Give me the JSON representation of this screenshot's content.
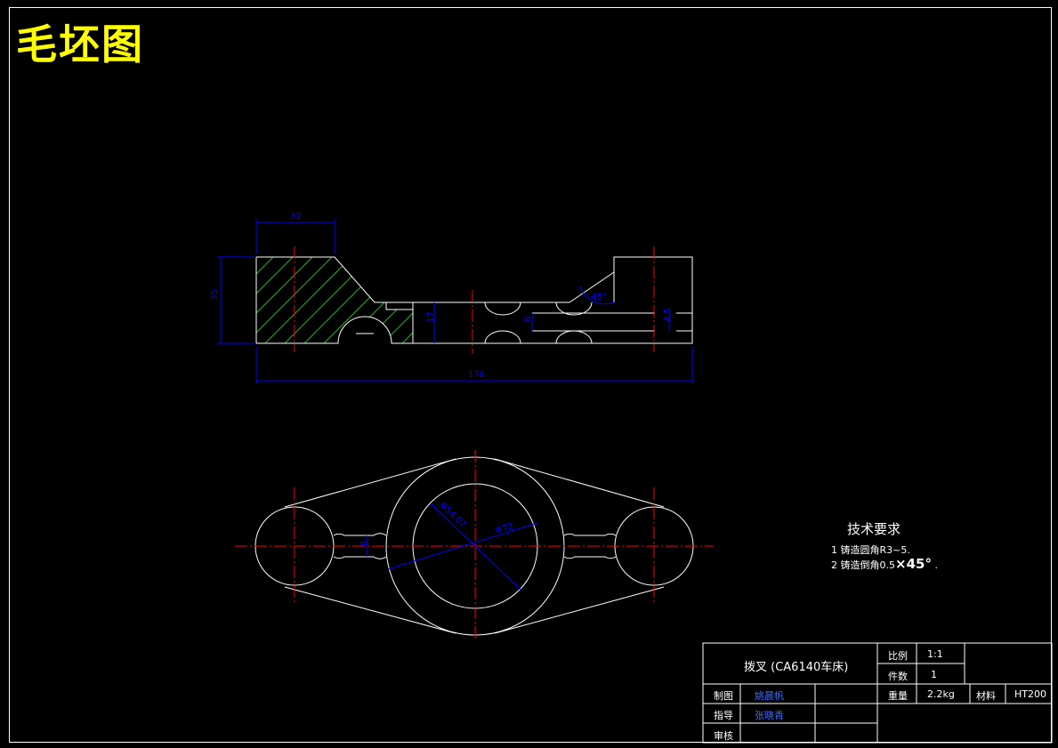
{
  "title": "毛坯图",
  "dimensions": {
    "width_top": "32",
    "height_left": "35",
    "web": "17",
    "slot": "8",
    "rib": "4.5",
    "angle": "45°",
    "overall": "176",
    "bore_outer": "Φ72",
    "bore_inner": "Φ54.07",
    "neck": "8"
  },
  "tech_req": {
    "heading": "技术要求",
    "item1": "1 铸造圆角R3~5.",
    "item2_prefix": "2 铸造倒角0.5",
    "item2_suffix": "×45°",
    "item2_end": "."
  },
  "title_block": {
    "part_name": "拨叉 (CA6140车床)",
    "scale_label": "比例",
    "scale_value": "1:1",
    "qty_label": "件数",
    "qty_value": "1",
    "weight_label": "重量",
    "weight_value": "2.2kg",
    "material_label": "材料",
    "material_value": "HT200",
    "drawn_label": "制图",
    "drawn_name": "姚晨帆",
    "guide_label": "指导",
    "guide_name": "张晓青",
    "review_label": "审核"
  },
  "colors": {
    "background": "#000000",
    "outline": "#ffffff",
    "centerline": "#ff0000",
    "dimension": "#0000ff",
    "hatch": "#00cc00",
    "title": "#ffff00"
  }
}
